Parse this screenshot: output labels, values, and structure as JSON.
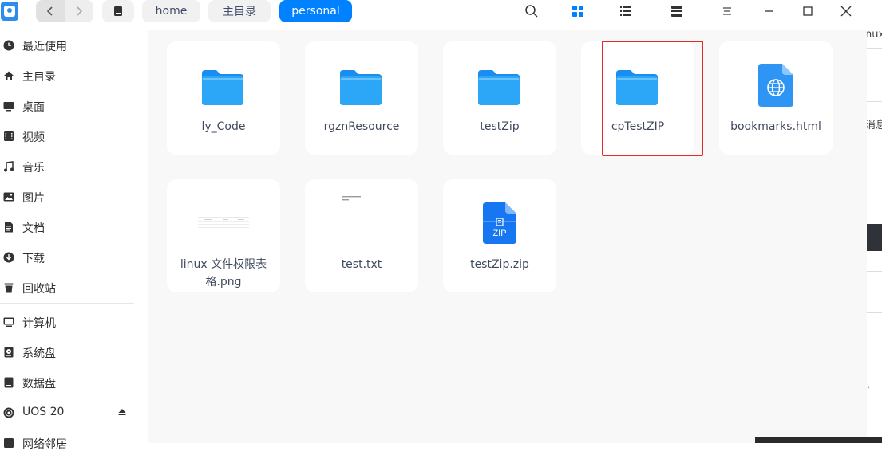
{
  "titlebar": {
    "breadcrumbs": [
      "home",
      "主目录",
      "personal"
    ],
    "active_crumb": "personal"
  },
  "sidebar": {
    "items": [
      {
        "label": "最近使用",
        "icon": "clock-icon"
      },
      {
        "label": "主目录",
        "icon": "home-icon"
      },
      {
        "label": "桌面",
        "icon": "desktop-icon"
      },
      {
        "label": "视频",
        "icon": "video-icon"
      },
      {
        "label": "音乐",
        "icon": "music-icon"
      },
      {
        "label": "图片",
        "icon": "picture-icon"
      },
      {
        "label": "文档",
        "icon": "document-icon"
      },
      {
        "label": "下载",
        "icon": "download-icon"
      },
      {
        "label": "回收站",
        "icon": "trash-icon"
      }
    ],
    "devices": [
      {
        "label": "计算机",
        "icon": "computer-icon"
      },
      {
        "label": "系统盘",
        "icon": "disk-icon"
      },
      {
        "label": "数据盘",
        "icon": "disk-icon"
      },
      {
        "label": "UOS 20",
        "icon": "disc-icon"
      }
    ],
    "cut_off_label": "网络邻居"
  },
  "files": [
    {
      "name": "ly_Code",
      "type": "folder"
    },
    {
      "name": "rgznResource",
      "type": "folder"
    },
    {
      "name": "testZip",
      "type": "folder"
    },
    {
      "name": "cpTestZIP",
      "type": "folder",
      "highlighted": true
    },
    {
      "name": "bookmarks.html",
      "type": "html"
    },
    {
      "name": "linux 文件权限表格.png",
      "type": "image"
    },
    {
      "name": "test.txt",
      "type": "text"
    },
    {
      "name": "testZip.zip",
      "type": "zip",
      "badge": "ZIP"
    }
  ],
  "background_window": {
    "text1": "nux",
    "text2": "消息"
  },
  "colors": {
    "accent": "#0081ff",
    "folder": "#2ca7f8",
    "highlight": "#e32a2a"
  }
}
